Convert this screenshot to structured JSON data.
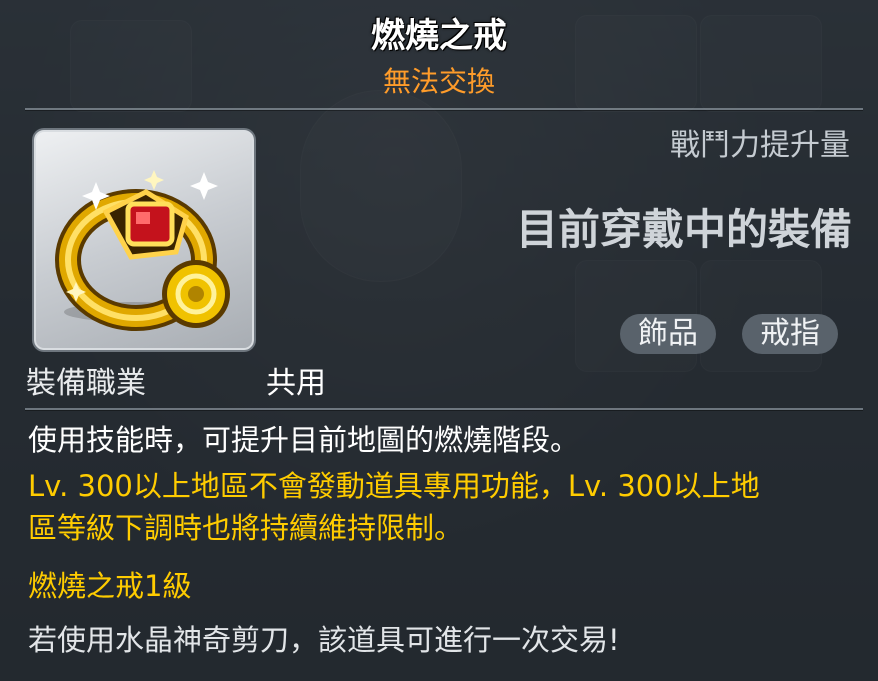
{
  "item": {
    "name": "燃燒之戒",
    "trade_status": "無法交換"
  },
  "stats": {
    "power_label": "戰鬥力提升量",
    "equipped_text": "目前穿戴中的裝備"
  },
  "tags": [
    "飾品",
    "戒指"
  ],
  "job": {
    "label": "裝備職業",
    "value": "共用"
  },
  "description": {
    "line1": "使用技能時，可提升目前地圖的燃燒階段。",
    "warning_line1": "Lv. 300以上地區不會發動道具專用功能，Lv. 300以上地",
    "warning_line2": "區等級下調時也將持續維持限制。",
    "level_text": "燃燒之戒1級",
    "scissors_note": "若使用水晶神奇剪刀，該道具可進行一次交易!"
  },
  "icon_name": "ruby-gold-ring-icon",
  "colors": {
    "title": "#ffffff",
    "trade_status": "#ff9c2a",
    "warning": "#ffcc00",
    "tag_bg": "#59626b"
  }
}
